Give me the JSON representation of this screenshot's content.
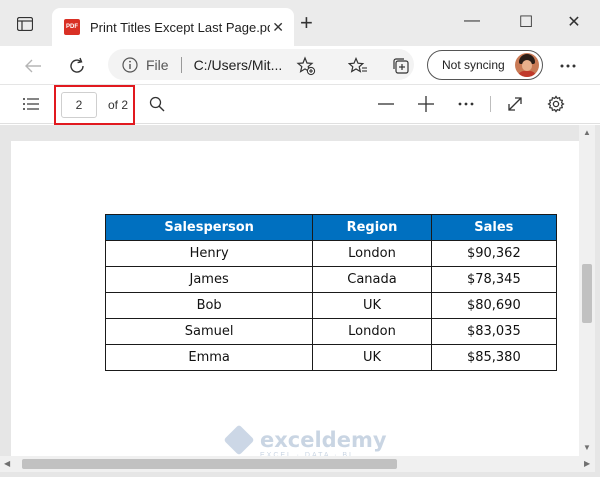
{
  "window": {
    "tab_title": "Print Titles Except Last Page.pdf",
    "pdf_badge": "PDF",
    "minimize": "—",
    "maximize": "☐",
    "close": "✕",
    "tab_close": "✕",
    "new_tab": "+"
  },
  "navbar": {
    "address_scheme_label": "File",
    "address_url": "C:/Users/Mit...",
    "sync_label": "Not syncing"
  },
  "pdf_toolbar": {
    "current_page": "2",
    "page_total_label": "of 2"
  },
  "table": {
    "headers": [
      "Salesperson",
      "Region",
      "Sales"
    ],
    "rows": [
      [
        "Henry",
        "London",
        "$90,362"
      ],
      [
        "James",
        "Canada",
        "$78,345"
      ],
      [
        "Bob",
        "UK",
        "$80,690"
      ],
      [
        "Samuel",
        "London",
        "$83,035"
      ],
      [
        "Emma",
        "UK",
        "$85,380"
      ]
    ],
    "header_color": "#0070c0"
  },
  "watermark": {
    "name": "exceldemy",
    "tagline": "EXCEL · DATA · BI"
  },
  "colors": {
    "highlight": "#e1191f",
    "viewer_bg": "#e6e6e6"
  },
  "icons": [
    "tab-actions-icon",
    "pdf-icon",
    "back-icon",
    "refresh-icon",
    "info-icon",
    "add-favorite-icon",
    "favorites-icon",
    "collections-icon",
    "more-icon",
    "contents-icon",
    "search-icon",
    "zoom-out-icon",
    "zoom-in-icon",
    "fit-page-icon",
    "settings-icon"
  ]
}
